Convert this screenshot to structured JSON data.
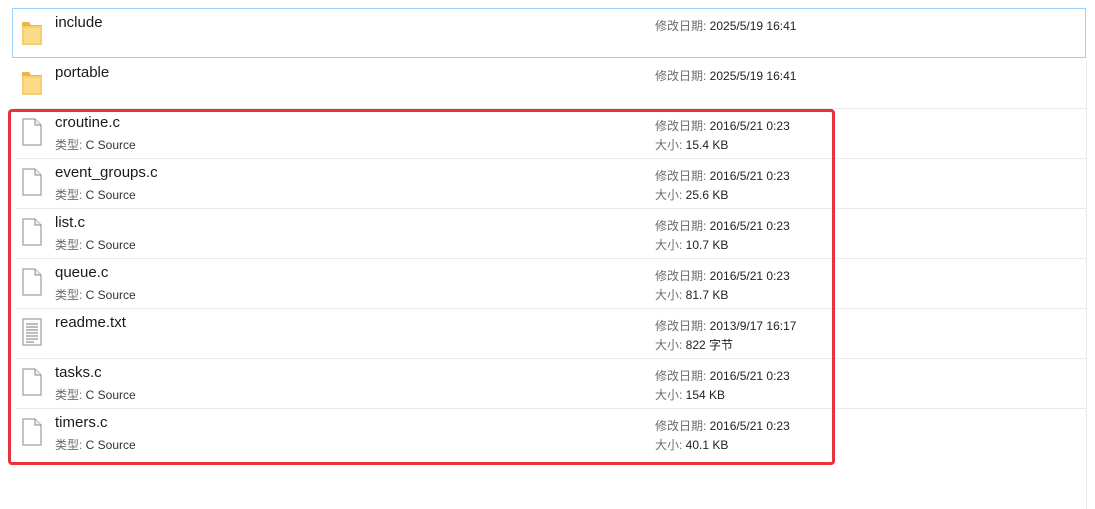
{
  "labels": {
    "modified": "修改日期: ",
    "type": "类型: ",
    "size": "大小: "
  },
  "items": [
    {
      "name": "include",
      "kind": "folder",
      "modified": "2025/5/19 16:41"
    },
    {
      "name": "portable",
      "kind": "folder",
      "modified": "2025/5/19 16:41"
    },
    {
      "name": "croutine.c",
      "kind": "file",
      "type": "C Source",
      "modified": "2016/5/21 0:23",
      "size": "15.4 KB"
    },
    {
      "name": "event_groups.c",
      "kind": "file",
      "type": "C Source",
      "modified": "2016/5/21 0:23",
      "size": "25.6 KB"
    },
    {
      "name": "list.c",
      "kind": "file",
      "type": "C Source",
      "modified": "2016/5/21 0:23",
      "size": "10.7 KB"
    },
    {
      "name": "queue.c",
      "kind": "file",
      "type": "C Source",
      "modified": "2016/5/21 0:23",
      "size": "81.7 KB"
    },
    {
      "name": "readme.txt",
      "kind": "text-file",
      "modified": "2013/9/17 16:17",
      "size": "822 字节"
    },
    {
      "name": "tasks.c",
      "kind": "file",
      "type": "C Source",
      "modified": "2016/5/21 0:23",
      "size": "154 KB"
    },
    {
      "name": "timers.c",
      "kind": "file",
      "type": "C Source",
      "modified": "2016/5/21 0:23",
      "size": "40.1 KB"
    }
  ],
  "colors": {
    "selection_border": "#99d1ff",
    "highlight_box": "#e8323c",
    "folder": "#f4c55a"
  }
}
